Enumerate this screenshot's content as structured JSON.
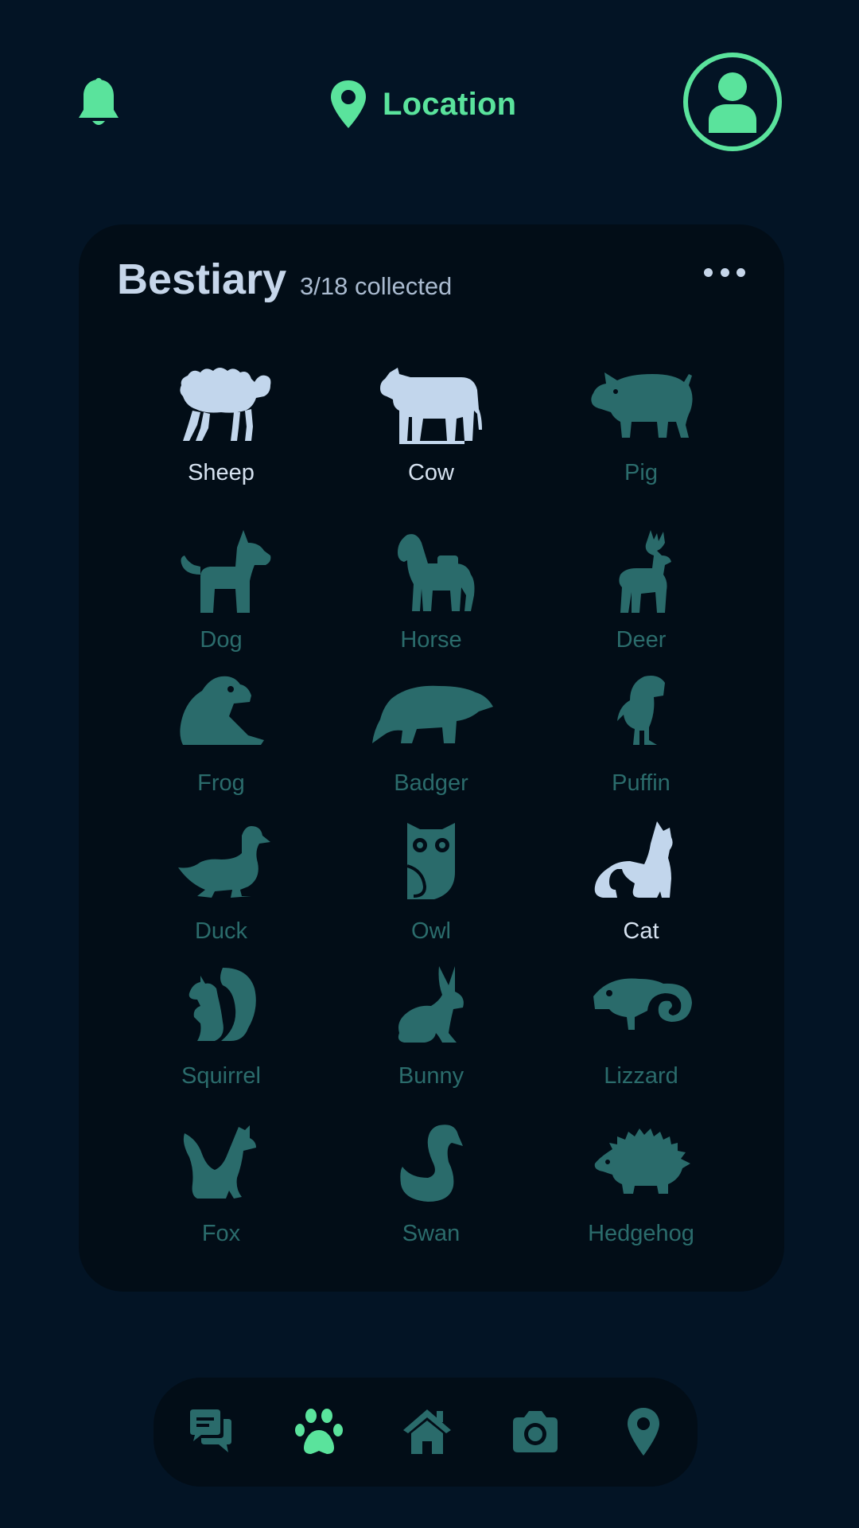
{
  "header": {
    "location_label": "Location"
  },
  "card": {
    "title": "Bestiary",
    "count": "3/18 collected",
    "animals": [
      {
        "name": "Sheep",
        "collected": true
      },
      {
        "name": "Cow",
        "collected": true
      },
      {
        "name": "Pig",
        "collected": false
      },
      {
        "name": "Dog",
        "collected": false
      },
      {
        "name": "Horse",
        "collected": false
      },
      {
        "name": "Deer",
        "collected": false
      },
      {
        "name": "Frog",
        "collected": false
      },
      {
        "name": "Badger",
        "collected": false
      },
      {
        "name": "Puffin",
        "collected": false
      },
      {
        "name": "Duck",
        "collected": false
      },
      {
        "name": "Owl",
        "collected": false
      },
      {
        "name": "Cat",
        "collected": true
      },
      {
        "name": "Squirrel",
        "collected": false
      },
      {
        "name": "Bunny",
        "collected": false
      },
      {
        "name": "Lizzard",
        "collected": false
      },
      {
        "name": "Fox",
        "collected": false
      },
      {
        "name": "Swan",
        "collected": false
      },
      {
        "name": "Hedgehog",
        "collected": false
      }
    ]
  },
  "nav": {
    "items": [
      {
        "icon": "chat-icon",
        "active": false
      },
      {
        "icon": "paw-icon",
        "active": true
      },
      {
        "icon": "home-icon",
        "active": false
      },
      {
        "icon": "camera-icon",
        "active": false
      },
      {
        "icon": "map-pin-icon",
        "active": false
      }
    ]
  },
  "colors": {
    "background": "#031425",
    "card": "#020d17",
    "accent": "#5ae39c",
    "collected": "#c2d6ec",
    "uncollected": "#2a6b6b",
    "title": "#c6d6ea"
  }
}
